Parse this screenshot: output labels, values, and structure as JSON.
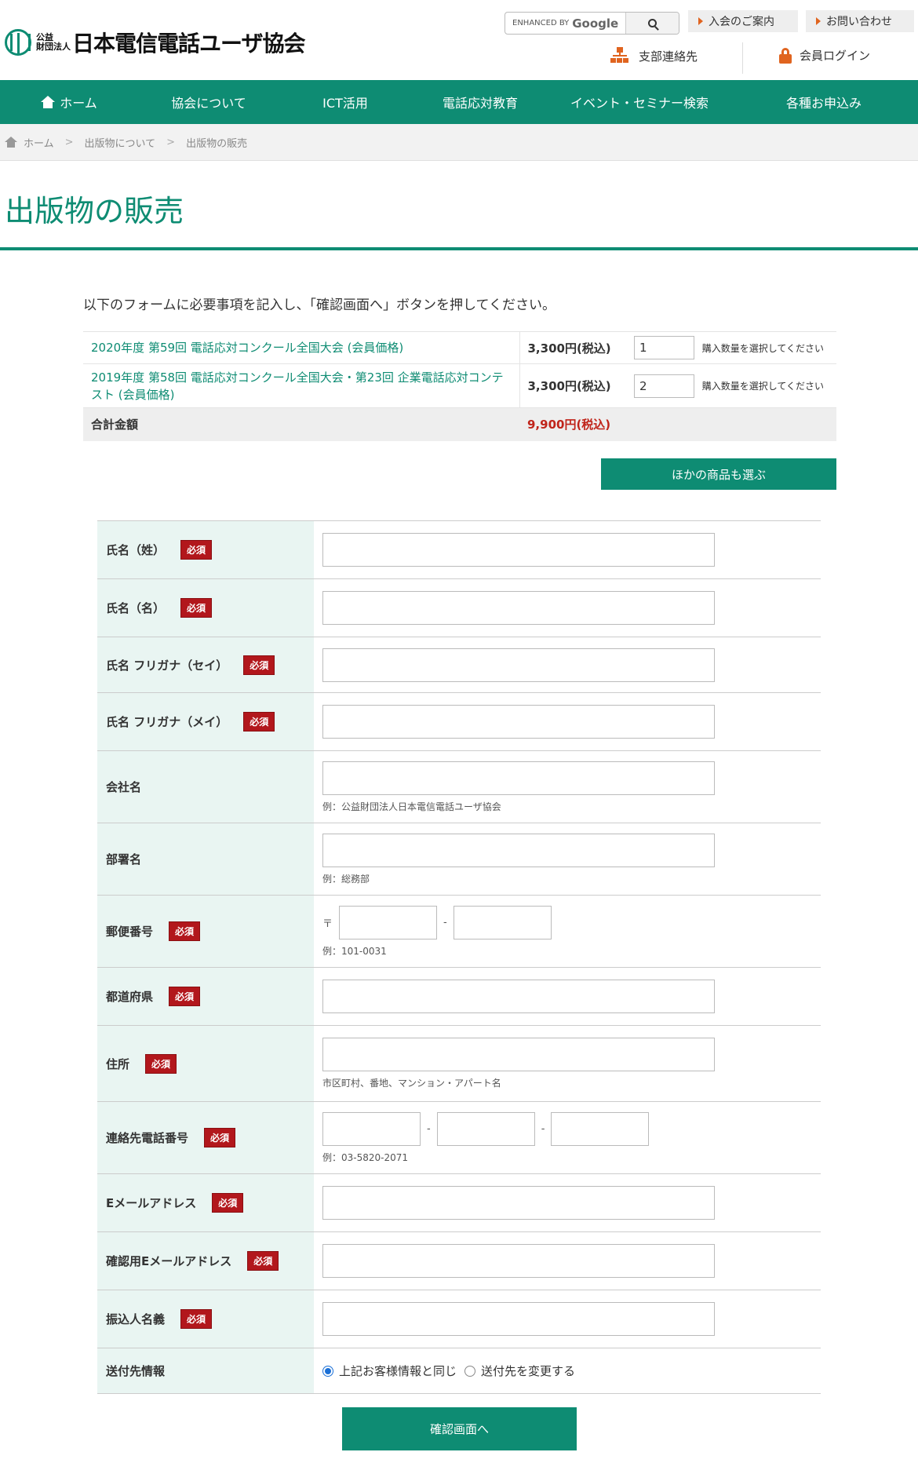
{
  "header": {
    "logo_small_top": "公益",
    "logo_small_bottom": "財団法人",
    "logo_name": "日本電信電話ユーザ協会",
    "search": {
      "enhanced_by": "ENHANCED BY",
      "brand": "Google",
      "icon": "search-icon"
    },
    "links": {
      "join": "入会のご案内",
      "contact": "お問い合わせ"
    },
    "util": {
      "branch": "支部連絡先",
      "login": "会員ログイン"
    }
  },
  "nav": {
    "items": [
      {
        "label": "ホーム",
        "icon": "home-icon"
      },
      {
        "label": "協会について"
      },
      {
        "label": "ICT活用"
      },
      {
        "label": "電話応対教育"
      },
      {
        "label": "イベント・セミナー検索"
      },
      {
        "label": "各種お申込み"
      }
    ]
  },
  "breadcrumb": {
    "items": [
      "ホーム",
      "出版物について",
      "出版物の販売"
    ],
    "separator": ">"
  },
  "page": {
    "title": "出版物の販売",
    "intro": "以下のフォームに必要事項を記入し、「確認画面へ」ボタンを押してください。"
  },
  "cart": {
    "items": [
      {
        "name": "2020年度 第59回 電話応対コンクール全国大会 (会員価格)",
        "price": "3,300円(税込)",
        "qty": "1",
        "qty_note": "購入数量を選択してください"
      },
      {
        "name": "2019年度 第58回 電話応対コンクール全国大会・第23回 企業電話応対コンテスト (会員価格)",
        "price": "3,300円(税込)",
        "qty": "2",
        "qty_note": "購入数量を選択してください"
      }
    ],
    "total_label": "合計金額",
    "total_price": "9,900円(税込)",
    "other_button": "ほかの商品も選ぶ"
  },
  "form": {
    "required_badge": "必須",
    "fields": {
      "last_name": "氏名（姓）",
      "first_name": "氏名（名）",
      "last_kana": "氏名 フリガナ（セイ）",
      "first_kana": "氏名 フリガナ（メイ）",
      "company": "会社名",
      "company_hint": "例：公益財団法人日本電信電話ユーザ協会",
      "department": "部署名",
      "department_hint": "例：総務部",
      "zip": "郵便番号",
      "zip_mark": "〒",
      "zip_hint": "例：101-0031",
      "prefecture": "都道府県",
      "address": "住所",
      "address_hint": "市区町村、番地、マンション・アパート名",
      "tel": "連絡先電話番号",
      "tel_hint": "例：03-5820-2071",
      "email": "Eメールアドレス",
      "email_confirm": "確認用Eメールアドレス",
      "payer": "振込人名義",
      "shipping": "送付先情報",
      "shipping_same": "上記お客様情報と同じ",
      "shipping_change": "送付先を変更する"
    },
    "dash": "-",
    "submit": "確認画面へ"
  }
}
